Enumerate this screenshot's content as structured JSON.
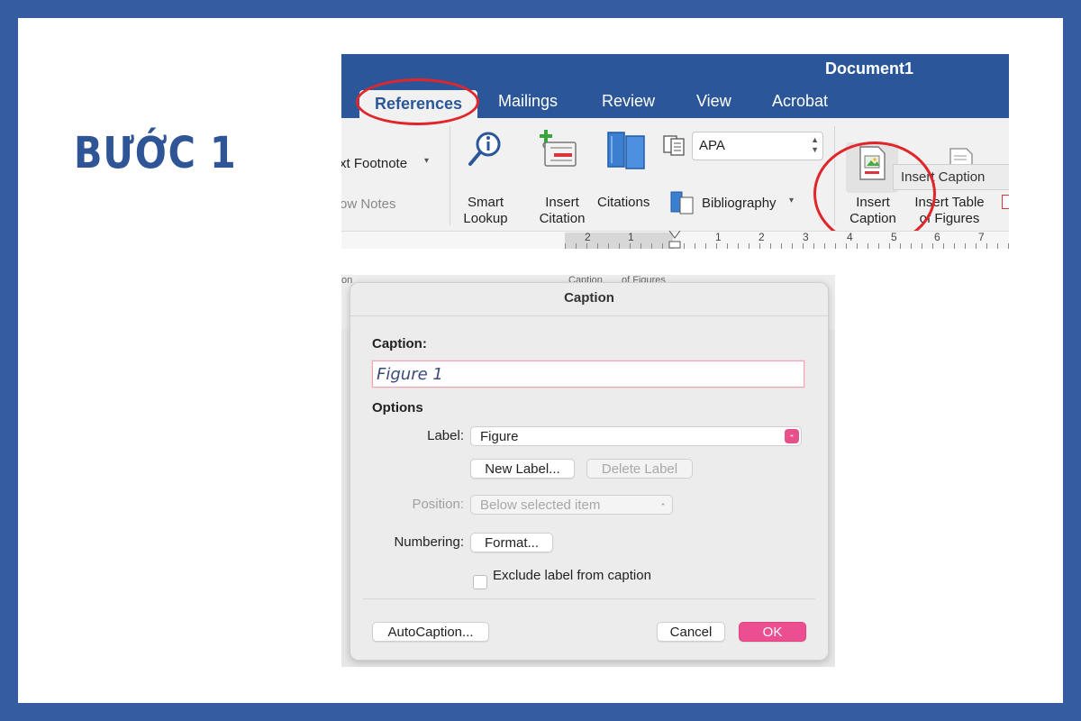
{
  "step_title": "BƯỚC 1",
  "ribbon": {
    "document_title": "Document1",
    "tabs": [
      {
        "label": "References",
        "active": true
      },
      {
        "label": "Mailings"
      },
      {
        "label": "Review"
      },
      {
        "label": "View"
      },
      {
        "label": "Acrobat"
      }
    ],
    "next_footnote": "xt Footnote",
    "show_notes": "ow Notes",
    "smart_lookup": [
      "Smart",
      "Lookup"
    ],
    "insert_citation": [
      "Insert",
      "Citation"
    ],
    "citations": "Citations",
    "style_value": "APA",
    "bibliography": "Bibliography",
    "insert_caption": [
      "Insert",
      "Caption"
    ],
    "insert_table_of_figures": [
      "Insert Table",
      "of Figures"
    ],
    "tooltip": "Insert Caption",
    "ruler_numbers": [
      "2",
      "1",
      "1",
      "2",
      "3",
      "4",
      "5",
      "6",
      "7"
    ],
    "highlight_color": "#e0262a"
  },
  "dialog": {
    "title": "Caption",
    "caption_label": "Caption:",
    "caption_value": "Figure 1",
    "options_heading": "Options",
    "label_label": "Label:",
    "label_value": "Figure",
    "new_label_button": "New Label...",
    "delete_label_button": "Delete Label",
    "position_label": "Position:",
    "position_value": "Below selected item",
    "numbering_label": "Numbering:",
    "format_button": "Format...",
    "exclude_checkbox_label": "Exclude label from caption",
    "exclude_checked": false,
    "autocaption_button": "AutoCaption...",
    "cancel_button": "Cancel",
    "ok_button": "OK",
    "accent_color": "#ec4f91",
    "bg_fragments": [
      "on",
      "Caption",
      "of Figures"
    ]
  }
}
